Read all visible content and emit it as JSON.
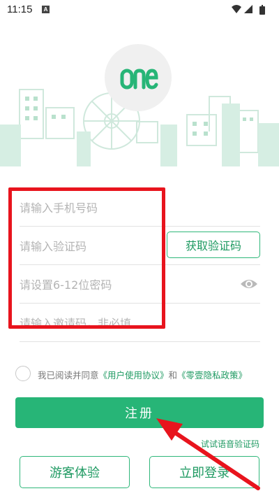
{
  "status_bar": {
    "time": "11:15",
    "notif_letter": "A"
  },
  "form": {
    "phone_placeholder": "请输入手机号码",
    "code_placeholder": "请输入验证码",
    "get_code_label": "获取验证码",
    "password_placeholder": "请设置6-12位密码",
    "invite_placeholder": "请输入邀请码，非必填"
  },
  "agreement": {
    "prefix": "我已阅读并同意",
    "user_agreement": "《用户使用协议》",
    "joiner": "和",
    "privacy_policy": "《零壹隐私政策》"
  },
  "register_label": "注册",
  "voice_code_label": "试试语音验证码",
  "guest_label": "游客体验",
  "login_label": "立即登录",
  "colors": {
    "brand": "#27b577",
    "highlight": "#e8141d"
  }
}
